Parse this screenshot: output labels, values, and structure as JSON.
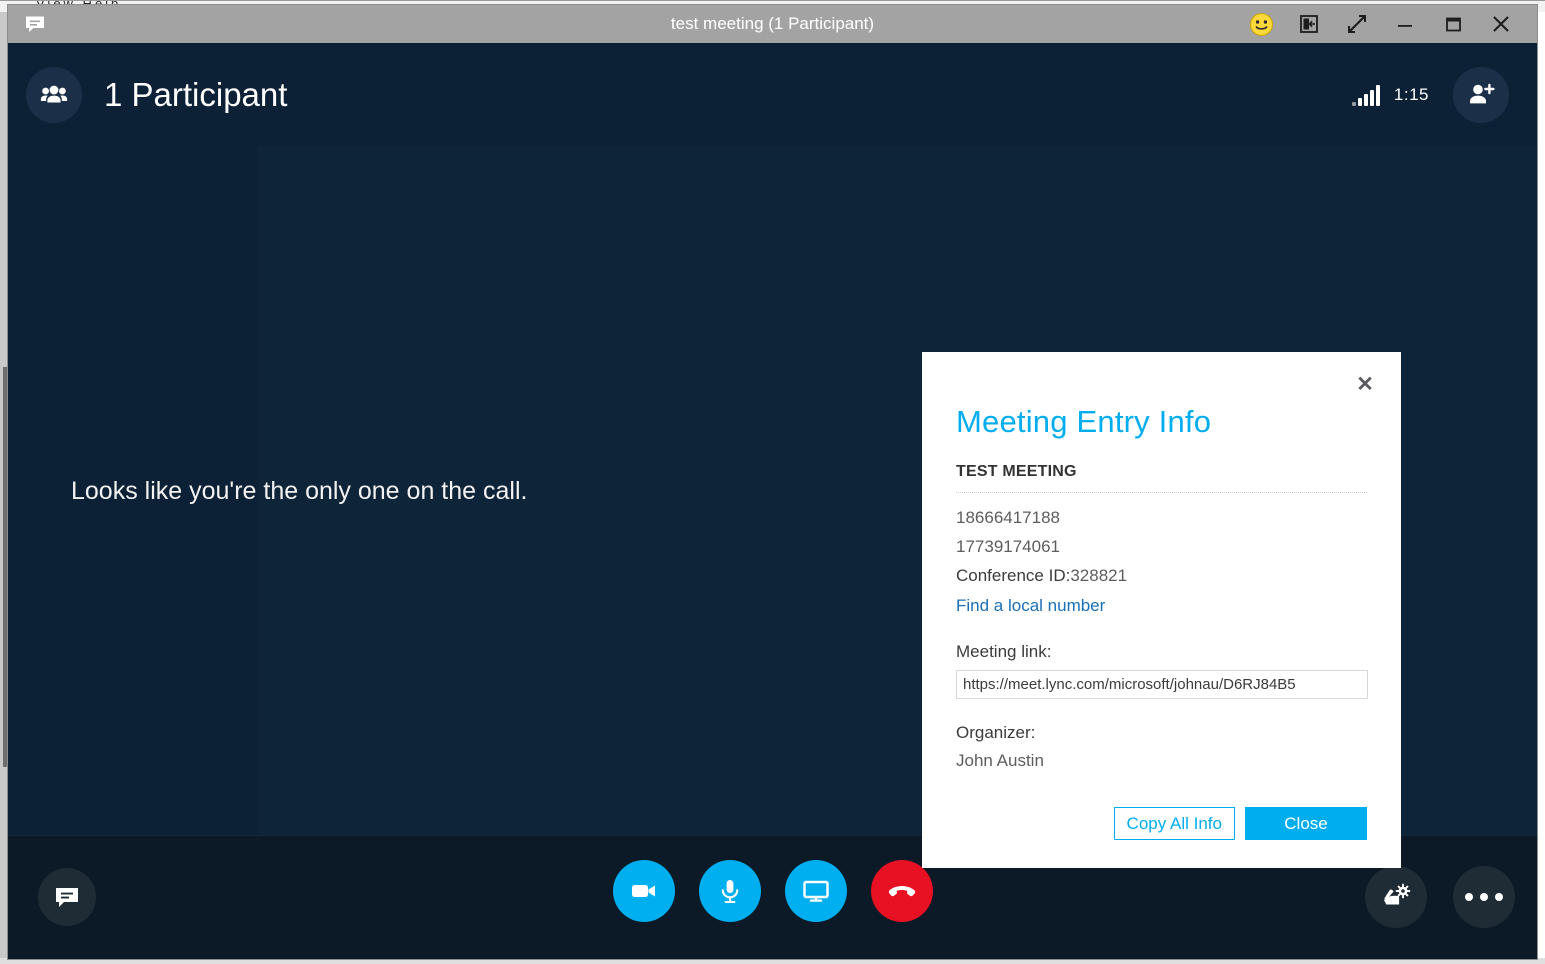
{
  "background_window": {
    "menu_text": "View   Help"
  },
  "title_bar": {
    "title": "test meeting (1 Participant)",
    "chat_icon": "chat-bubble-icon",
    "emoji_icon": "smiley-face-icon",
    "emoji_glyph": "🙂",
    "dock_icon": "pop-in-icon",
    "expand_icon": "expand-arrows-icon",
    "minimize_icon": "minimize-icon",
    "maximize_icon": "maximize-icon",
    "close_icon": "close-icon"
  },
  "header": {
    "participants_icon": "people-group-icon",
    "participant_count_label": "1 Participant",
    "signal_icon": "signal-strength-icon",
    "call_timer": "1:15",
    "add_participant_icon": "add-person-icon"
  },
  "stage": {
    "message": "Looks like you're the only one on the call."
  },
  "control_bar": {
    "chat_icon": "chat-bubble-icon",
    "video_icon": "video-camera-icon",
    "mic_icon": "microphone-icon",
    "share_icon": "monitor-screen-share-icon",
    "end_call_icon": "hangup-phone-icon",
    "call_settings_icon": "phone-gear-icon",
    "more_options_icon": "ellipsis-icon"
  },
  "dialog": {
    "close_icon": "close-icon",
    "close_glyph": "✕",
    "title": "Meeting Entry Info",
    "subject": "TEST MEETING",
    "dial_in_numbers": [
      "18666417188",
      "17739174061"
    ],
    "conference_id_label": "Conference ID:",
    "conference_id_value": "328821",
    "find_local_number_link": "Find a local number",
    "meeting_link_label": "Meeting link:",
    "meeting_link_value": "https://meet.lync.com/microsoft/johnau/D6RJ84B5",
    "organizer_label": "Organizer:",
    "organizer_name": "John Austin",
    "copy_all_info_label": "Copy All Info",
    "close_label": "Close"
  },
  "colors": {
    "accent_blue": "#00aeef",
    "window_bg": "#0d2136",
    "control_bar_bg": "#0b1a26",
    "end_call_red": "#e81123",
    "title_bar_gray": "#a3a3a3",
    "link_blue": "#1a6fb5"
  }
}
